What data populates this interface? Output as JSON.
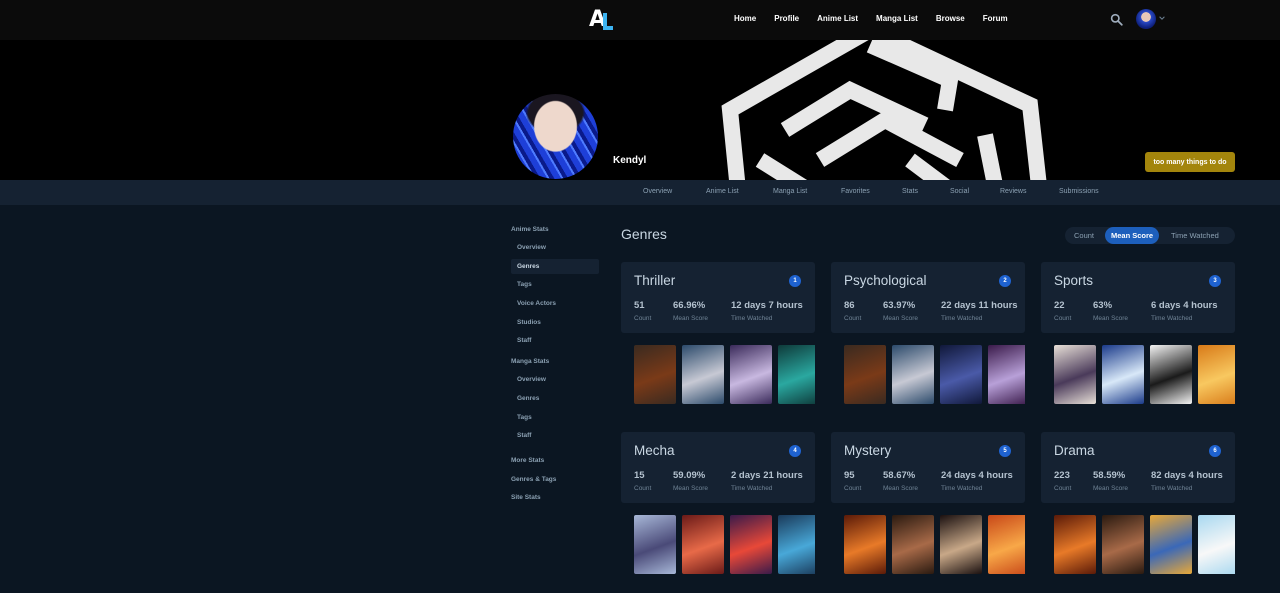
{
  "nav": {
    "links": [
      "Home",
      "Profile",
      "Anime List",
      "Manga List",
      "Browse",
      "Forum"
    ]
  },
  "profile": {
    "username": "Kendyl",
    "status_button": "too many things to do"
  },
  "subnav": {
    "items": [
      "Overview",
      "Anime List",
      "Manga List",
      "Favorites",
      "Stats",
      "Social",
      "Reviews",
      "Submissions"
    ]
  },
  "sidebar": {
    "anime_heading": "Anime Stats",
    "anime_items": [
      "Overview",
      "Genres",
      "Tags",
      "Voice Actors",
      "Studios",
      "Staff"
    ],
    "manga_heading": "Manga Stats",
    "manga_items": [
      "Overview",
      "Genres",
      "Tags",
      "Staff"
    ],
    "more_heading": "More Stats",
    "more_items": [
      "Genres & Tags",
      "Site Stats"
    ]
  },
  "main": {
    "title": "Genres",
    "sort_options": [
      "Count",
      "Mean Score",
      "Time Watched"
    ],
    "selected_sort": "Mean Score"
  },
  "stat_labels": {
    "count": "Count",
    "mean": "Mean Score",
    "time": "Time Watched"
  },
  "genres": [
    {
      "name": "Thriller",
      "rank": "1",
      "count": "51",
      "mean": "66.96%",
      "time": "12 days 7 hours"
    },
    {
      "name": "Psychological",
      "rank": "2",
      "count": "86",
      "mean": "63.97%",
      "time": "22 days 11 hours"
    },
    {
      "name": "Sports",
      "rank": "3",
      "count": "22",
      "mean": "63%",
      "time": "6 days 4 hours"
    },
    {
      "name": "Mecha",
      "rank": "4",
      "count": "15",
      "mean": "59.09%",
      "time": "2 days 21 hours"
    },
    {
      "name": "Mystery",
      "rank": "5",
      "count": "95",
      "mean": "58.67%",
      "time": "24 days 4 hours"
    },
    {
      "name": "Drama",
      "rank": "6",
      "count": "223",
      "mean": "58.59%",
      "time": "82 days 4 hours"
    }
  ],
  "colors": {
    "accent": "#1e62d0",
    "status_button": "#a3850c",
    "logo": "#3db4f2"
  }
}
